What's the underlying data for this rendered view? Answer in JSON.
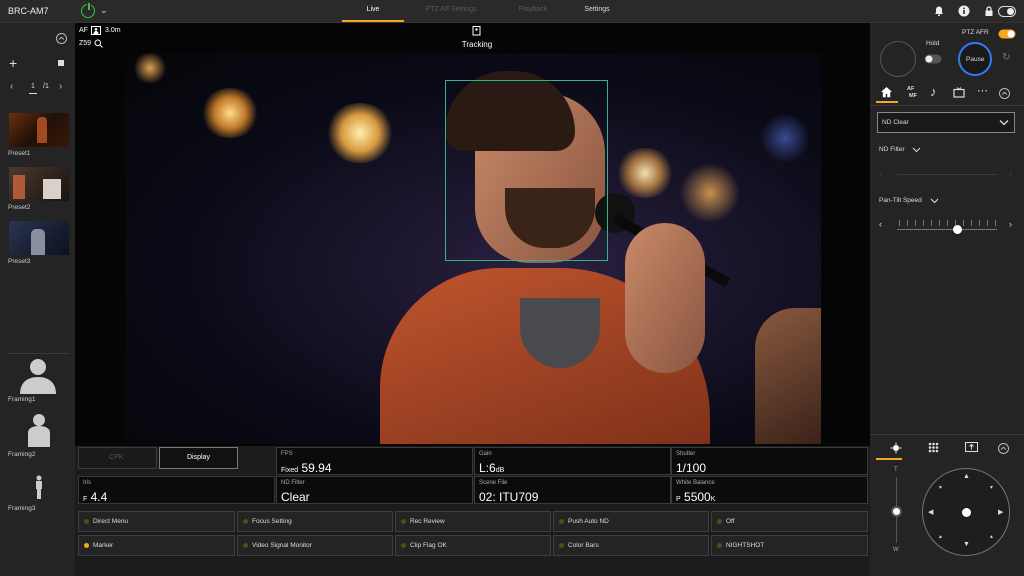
{
  "header": {
    "model": "BRC-AM7",
    "tabs": [
      "Live",
      "PTZ AF Settings",
      "Playback",
      "Settings"
    ]
  },
  "left": {
    "page": {
      "current": "1",
      "total": "/1"
    },
    "presets": [
      {
        "label": "Preset1"
      },
      {
        "label": "Preset2"
      },
      {
        "label": "Preset3"
      }
    ],
    "framings": [
      {
        "label": "Framing1"
      },
      {
        "label": "Framing2"
      },
      {
        "label": "Framing3"
      }
    ]
  },
  "overlay": {
    "af": "AF",
    "distance": "3.0m",
    "zoom": "Z59",
    "tracking": "Tracking"
  },
  "info": {
    "tabs": {
      "off": "CPK",
      "display": "Display"
    },
    "fps": {
      "label": "FPS",
      "prefix": "Fixed",
      "value": "59.94"
    },
    "gain": {
      "label": "Gain",
      "value": "L:6",
      "unit": "dB"
    },
    "shutter": {
      "label": "Shutter",
      "value": "1/100"
    },
    "iris": {
      "label": "Iris",
      "prefix": "F",
      "value": "4.4"
    },
    "nd": {
      "label": "ND Filter",
      "value": "Clear"
    },
    "scene": {
      "label": "Scene File",
      "value": "02: ITU709"
    },
    "wb": {
      "label": "White Balance",
      "prefix": "P",
      "value": "5500",
      "unit": "K"
    }
  },
  "buttons": [
    {
      "label": "Direct Menu",
      "active": false
    },
    {
      "label": "Focus Setting",
      "active": false
    },
    {
      "label": "Rec Review",
      "active": false
    },
    {
      "label": "Push Auto ND",
      "active": false
    },
    {
      "label": "Off",
      "active": false
    },
    {
      "label": "Marker",
      "active": true
    },
    {
      "label": "Video Signal Monitor",
      "active": false
    },
    {
      "label": "Clip Flag OK",
      "active": false
    },
    {
      "label": "Color Bars",
      "active": false
    },
    {
      "label": "NIGHTSHOT",
      "active": false
    }
  ],
  "right": {
    "hold": "Hold",
    "ptz_afr": "PTZ AFR",
    "pause": "Pause",
    "mini_tabs": {
      "af_mf_1": "AF",
      "af_mf_2": "MF"
    },
    "nd_select": "ND Clear",
    "nd_filter": "ND Filter",
    "pan_tilt_speed": "Pan-Tilt Speed",
    "pan_tilt_speed_level": 0.6,
    "zoom_t": "T",
    "zoom_w": "W"
  },
  "colors": {
    "accent": "#f5a623",
    "power": "#36c24a",
    "track": "#2fb58b",
    "pause_ring": "#2f7cf6"
  }
}
